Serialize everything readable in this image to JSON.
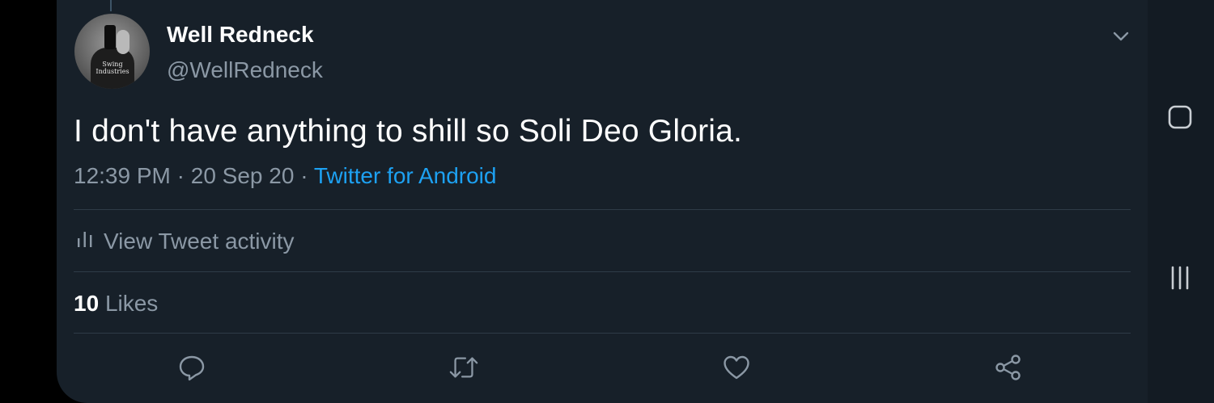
{
  "tweet": {
    "author_name": "Well Redneck",
    "author_handle": "@WellRedneck",
    "avatar_shirt_text": "Swing Industries",
    "text": "I don't have anything to shill so Soli Deo Gloria.",
    "time": "12:39 PM",
    "date": "20 Sep 20",
    "separator": "·",
    "source": "Twitter for Android",
    "activity_label": "View Tweet activity",
    "likes_count": "10",
    "likes_label": "Likes"
  },
  "icons": {
    "menu": "chevron-down-icon",
    "activity": "bar-chart-icon",
    "reply": "reply-icon",
    "retweet": "retweet-icon",
    "like": "heart-icon",
    "share": "share-icon",
    "recents": "recents-icon",
    "home": "home-icon"
  },
  "colors": {
    "background": "#172029",
    "text_primary": "#ffffff",
    "text_secondary": "#8b98a5",
    "link": "#1da1f2"
  }
}
